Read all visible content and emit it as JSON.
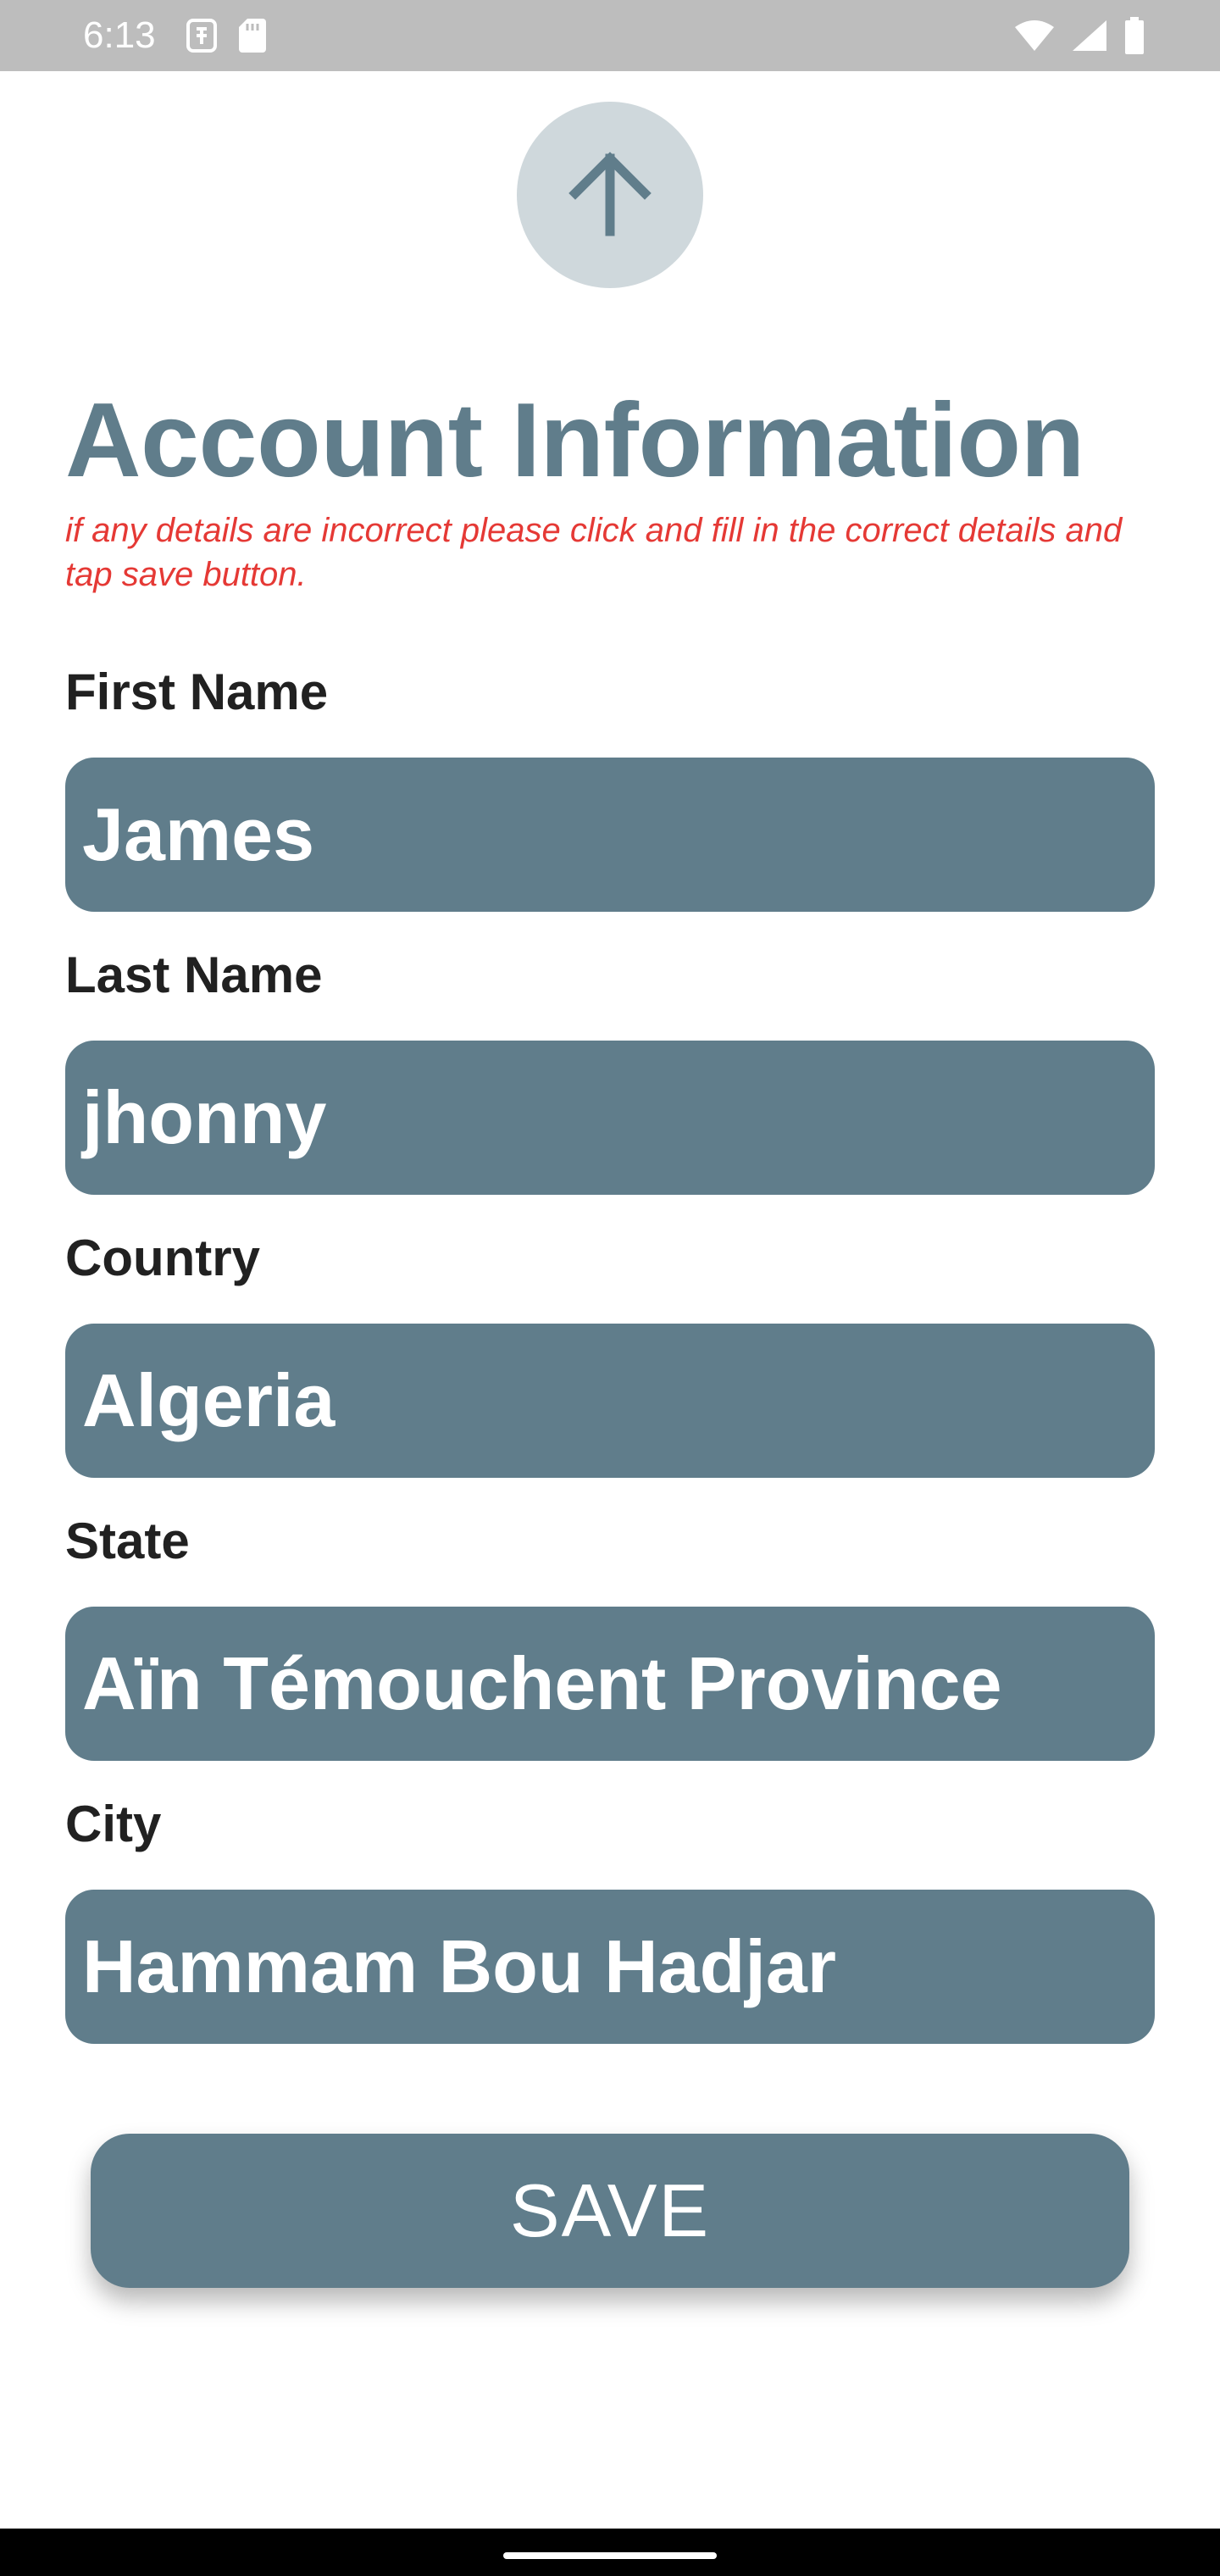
{
  "status_bar": {
    "time": "6:13",
    "left_icons": [
      "sd-card-icon",
      "sim-card-icon"
    ],
    "right_icons": [
      "wifi-icon",
      "cell-signal-icon",
      "battery-icon"
    ]
  },
  "header": {
    "up_button_icon": "arrow-up-icon"
  },
  "page": {
    "title": "Account Information",
    "note": "if any details are incorrect please click and fill in the correct details and tap save button."
  },
  "form": {
    "first_name": {
      "label": "First Name",
      "value": "James"
    },
    "last_name": {
      "label": "Last Name",
      "value": "jhonny"
    },
    "country": {
      "label": "Country",
      "value": "Algeria"
    },
    "state": {
      "label": "State",
      "value": "Aïn Témouchent Province"
    },
    "city": {
      "label": "City",
      "value": "Hammam Bou Hadjar"
    },
    "save_label": "SAVE"
  },
  "colors": {
    "accent": "#607d8b",
    "accent_light": "#cfd8dc",
    "note_red": "#e53935",
    "status_bar": "#bdbdbd"
  }
}
